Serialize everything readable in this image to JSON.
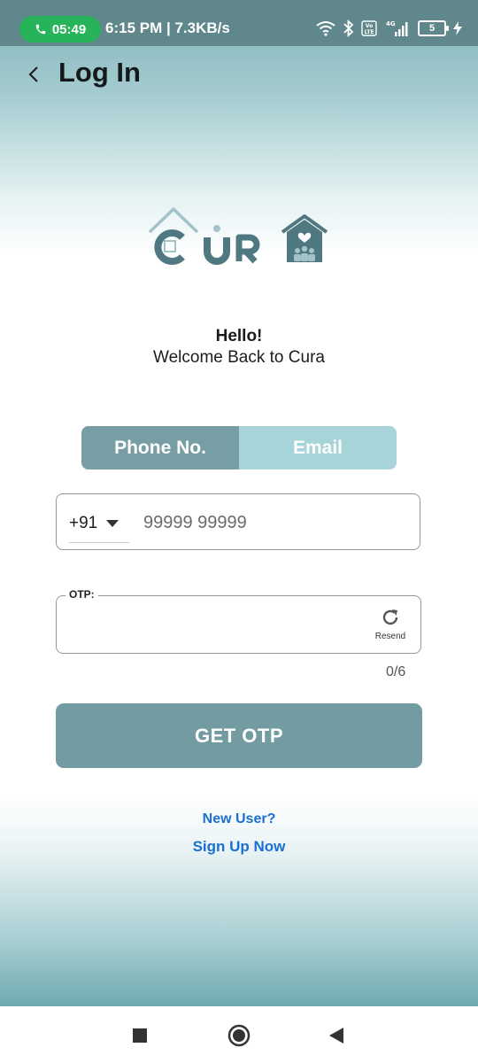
{
  "status_bar": {
    "call_time": "05:49",
    "info": "6:15 PM | 7.3KB/s",
    "battery_level": "5",
    "network_label": "4G",
    "volte_label": "Vo LTE"
  },
  "header": {
    "title": "Log In"
  },
  "logo": {
    "text": "CURA",
    "accent_color": "#4f7880"
  },
  "greeting": {
    "hello": "Hello!",
    "subtitle": "Welcome Back to Cura"
  },
  "login_toggle": {
    "options": [
      "Phone No.",
      "Email"
    ],
    "selected": "Phone No."
  },
  "phone": {
    "country_code": "+91",
    "placeholder": "99999 99999",
    "value": ""
  },
  "otp": {
    "label": "OTP:",
    "value": "",
    "resend_label": "Resend",
    "counter": "0/6"
  },
  "actions": {
    "get_otp_label": "GET OTP",
    "new_user_label": "New User?",
    "sign_up_label": "Sign Up Now"
  },
  "colors": {
    "primary_button": "#729ca2",
    "toggle_selected": "#769ea4",
    "toggle_unselected": "#a6d4d9",
    "link": "#1b6fd1",
    "status_bar": "#5f878c"
  }
}
